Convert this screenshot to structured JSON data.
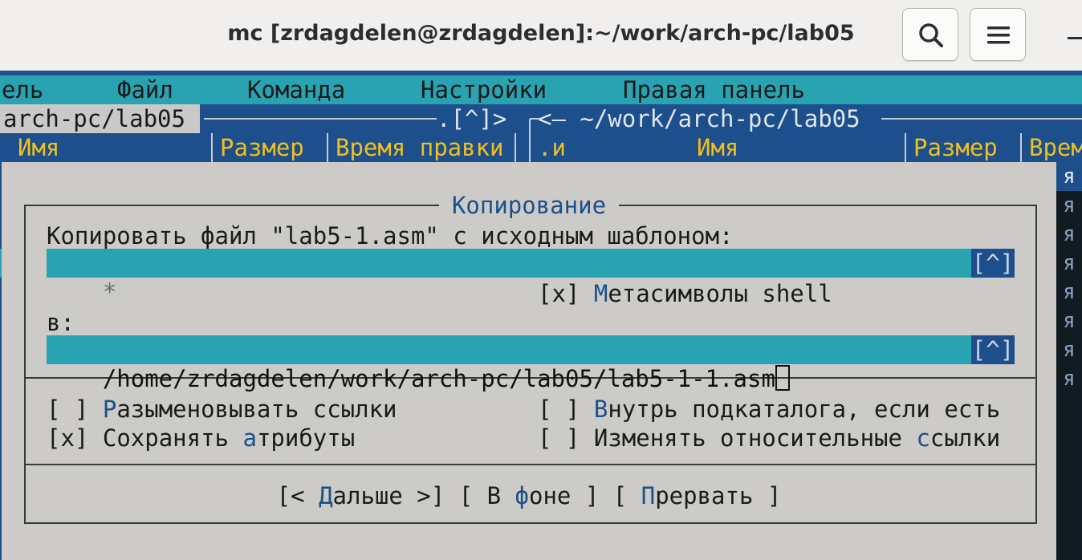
{
  "window": {
    "title": "mc [zrdagdelen@zrdagdelen]:~/work/arch-pc/lab05"
  },
  "menubar": {
    "items": [
      "ель",
      "Файл",
      "Команда",
      "Настройки",
      "Правая панель"
    ]
  },
  "left_panel": {
    "path": "arch-pc/lab05",
    "arrows": ".[^]>",
    "columns": [
      "Имя",
      "Размер",
      "Время правки"
    ]
  },
  "right_panel": {
    "path": "<— ~/work/arch-pc/lab05",
    "columns": [
      ".и",
      "Имя",
      "Размер",
      "Врем"
    ]
  },
  "dialog": {
    "title": "Копирование",
    "source_label": "Копировать файл \"lab5-1.asm\" с исходным шаблоном:",
    "source_value": "*",
    "history_button": "[^]",
    "shell_patterns": {
      "box": "[x]",
      "label_prefix": " ",
      "hotkey": "М",
      "label_rest": "етасимволы shell"
    },
    "dest_label": "в:",
    "dest_value": "/home/zrdagdelen/work/arch-pc/lab05/lab5-1-1.asm",
    "options": {
      "dereference": {
        "box": "[ ]",
        "hotkey": "Р",
        "rest": "азыменовывать ссылки"
      },
      "preserve_attrs": {
        "box": "[x]",
        "before": "Сохранять ",
        "hotkey": "а",
        "rest": "трибуты"
      },
      "dive_subdir": {
        "box": "[ ]",
        "hotkey": "В",
        "rest": "нутрь подкаталога, если есть"
      },
      "stable_symlinks": {
        "box": "[ ]",
        "before": "Изменять относительные ",
        "hotkey": "с",
        "rest": "сылки"
      }
    },
    "buttons": {
      "continue": {
        "open": "[< ",
        "hotkey": "Д",
        "rest": "альше",
        "close": " >]"
      },
      "background": {
        "open": "[ В ",
        "hotkey": "ф",
        "rest": "оне",
        "close": " ]"
      },
      "abort": {
        "open": "[ ",
        "hotkey": "П",
        "rest": "рервать",
        "close": " ]"
      }
    }
  },
  "right_edge_glyph": "я",
  "colors": {
    "terminal_bg": "#1c4f8c",
    "menubar_bg": "#29a2b2",
    "dialog_bg": "#cccbc7",
    "field_bg": "#29a2b2",
    "header_text": "#f0c020"
  }
}
